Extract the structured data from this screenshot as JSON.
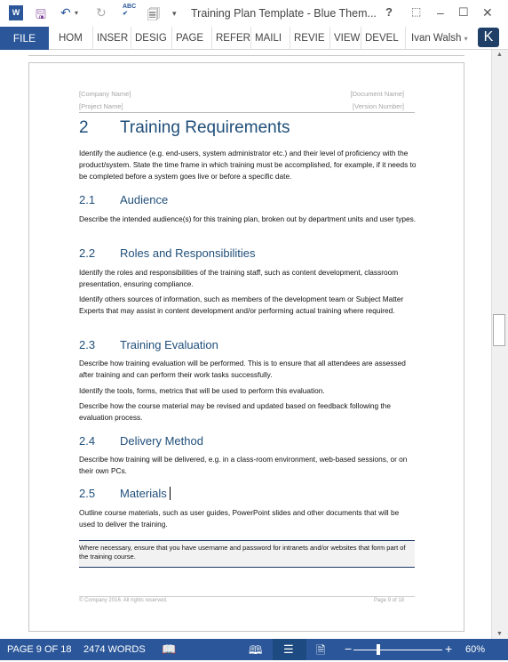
{
  "window": {
    "title": "Training Plan Template - Blue Them...",
    "help": "?",
    "user": "Ivan Walsh",
    "user_initial": "K"
  },
  "ribbon": {
    "file": "FILE",
    "tabs": [
      "HOM",
      "INSER",
      "DESIG",
      "PAGE",
      "REFER",
      "MAILI",
      "REVIE",
      "VIEW",
      "DEVEL"
    ]
  },
  "page_header": {
    "company": "[Company Name]",
    "document": "[Document Name]",
    "project": "[Project Name]",
    "version": "[Version Number]"
  },
  "section": {
    "num": "2",
    "title": "Training Requirements",
    "text": "Identify the audience (e.g. end-users, system administrator etc.) and their level of proficiency with the product/system. State the time frame in which training must be accomplished, for example, if it needs to be completed before a system goes live or before a specific date."
  },
  "subsections": [
    {
      "num": "2.1",
      "title": "Audience",
      "paras": [
        "Describe the intended audience(s) for this training plan, broken out by department units and user types."
      ]
    },
    {
      "num": "2.2",
      "title": "Roles and Responsibilities",
      "paras": [
        "Identify the roles and responsibilities of the training staff, such as content development, classroom presentation, ensuring compliance.",
        "Identify others sources of information, such as members of the development team or Subject Matter Experts that may assist in content development and/or performing actual training where required."
      ]
    },
    {
      "num": "2.3",
      "title": "Training Evaluation",
      "paras": [
        "Describe how training evaluation will be performed. This is to ensure that all attendees are assessed after training and can perform their work tasks successfully.",
        "Identify the tools, forms, metrics that will be used to perform this evaluation.",
        "Describe how the course material may be revised and updated based on feedback following the evaluation process."
      ]
    },
    {
      "num": "2.4",
      "title": "Delivery Method",
      "paras": [
        "Describe how training will be delivered, e.g. in a class-room environment, web-based sessions, or on their own PCs."
      ]
    },
    {
      "num": "2.5",
      "title": "Materials",
      "paras": [
        "Outline course materials, such as user guides, PowerPoint slides and other documents that will be used to deliver the training."
      ]
    }
  ],
  "callout": "Where necessary, ensure that you have username and password for intranets and/or websites that form part of the training course.",
  "footer": {
    "copyright": "© Company 2016. All rights reserved.",
    "page": "Page 9 of 18"
  },
  "status": {
    "page": "PAGE 9 OF 18",
    "words": "2474 WORDS",
    "zoom": "60%",
    "zoom_percent": 60
  }
}
